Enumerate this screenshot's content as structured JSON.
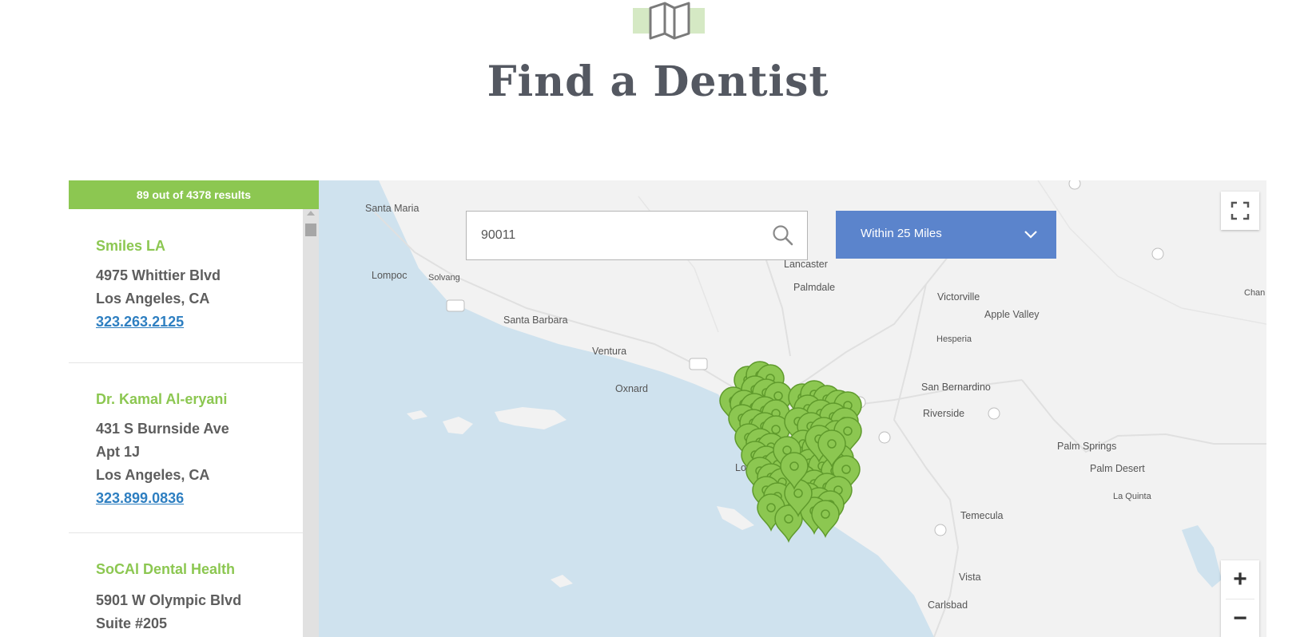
{
  "page": {
    "title": "Find a Dentist",
    "header_icon": "map-icon"
  },
  "results": {
    "summary": "89 out of 4378 results"
  },
  "listings": [
    {
      "name": "Smiles LA",
      "lines": [
        "4975 Whittier Blvd",
        "Los Angeles, CA"
      ],
      "phone": "323.263.2125"
    },
    {
      "name": "Dr. Kamal Al-eryani",
      "lines": [
        "431 S Burnside Ave",
        "Apt 1J",
        "Los Angeles, CA"
      ],
      "phone": "323.899.0836"
    },
    {
      "name": "SoCAl Dental Health",
      "lines": [
        "5901 W Olympic Blvd",
        "Suite #205"
      ],
      "phone": ""
    }
  ],
  "search": {
    "value": "90011",
    "icon": "search-icon"
  },
  "radius": {
    "label": "Within 25 Miles",
    "icon": "chevron-down-icon"
  },
  "map": {
    "places": [
      "Santa Maria",
      "Lompoc",
      "Solvang",
      "Santa Barbara",
      "Ventura",
      "Oxnard",
      "Lancaster",
      "Palmdale",
      "Victorville",
      "Apple Valley",
      "Hesperia",
      "San Bernardino",
      "Riverside",
      "Long Beach",
      "Palm Springs",
      "Palm Desert",
      "La Quinta",
      "Temecula",
      "Vista",
      "Carlsbad",
      "Chan"
    ],
    "controls": {
      "fullscreen_icon": "fullscreen-icon",
      "zoom_in": "+",
      "zoom_out": "−"
    }
  },
  "colors": {
    "brand_green": "#8cc751",
    "accent_blue": "#5b84cc",
    "link_blue": "#2e7fc1",
    "water": "#cfe2ee",
    "land": "#f2f2f2"
  }
}
